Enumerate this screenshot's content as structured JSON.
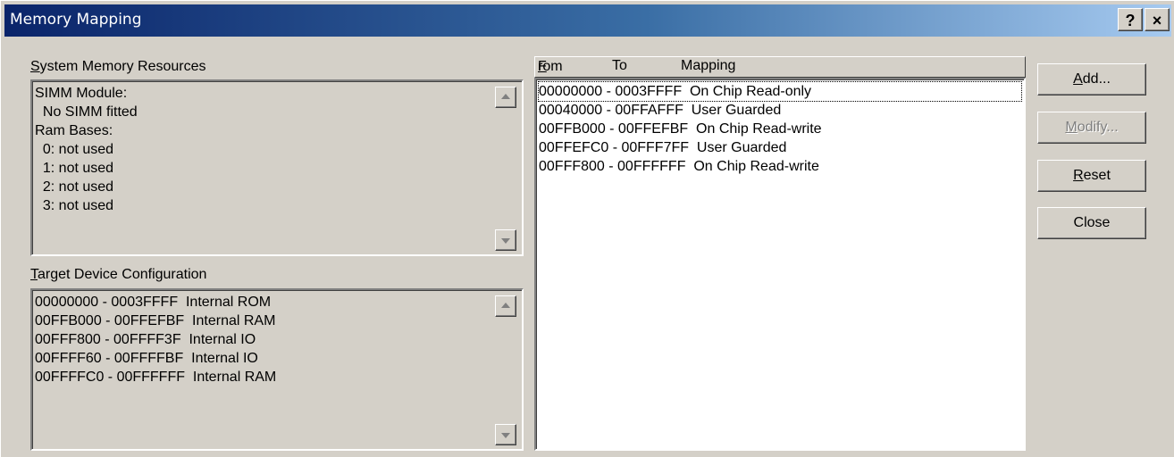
{
  "window": {
    "title": "Memory Mapping",
    "help_button": "?",
    "close_button": "×"
  },
  "system_memory": {
    "label_key": "S",
    "label_rest": "ystem Memory Resources",
    "lines": [
      "SIMM Module:",
      "  No SIMM fitted",
      "Ram Bases:",
      "  0: not used",
      "  1: not used",
      "  2: not used",
      "  3: not used"
    ]
  },
  "target_device": {
    "label_key": "T",
    "label_rest": "arget Device Configuration",
    "lines": [
      "00000000 - 0003FFFF  Internal ROM",
      "00FFB000 - 00FFEFBF  Internal RAM",
      "00FFF800 - 00FFFF3F  Internal IO",
      "00FFFF60 - 00FFFFBF  Internal IO",
      "00FFFFC0 - 00FFFFFF  Internal RAM"
    ]
  },
  "mapping_list": {
    "columns": {
      "from_key": "F",
      "from_rest": "rom",
      "to": "To",
      "mapping": "Mapping"
    },
    "rows": [
      "00000000 - 0003FFFF  On Chip Read-only",
      "00040000 - 00FFAFFF  User Guarded",
      "00FFB000 - 00FFEFBF  On Chip Read-write",
      "00FFEFC0 - 00FFF7FF  User Guarded",
      "00FFF800 - 00FFFFFF  On Chip Read-write"
    ]
  },
  "buttons": {
    "add_key": "A",
    "add_rest": "dd...",
    "modify_key": "M",
    "modify_rest": "odify...",
    "reset_key": "R",
    "reset_rest": "eset",
    "close": "Close"
  }
}
